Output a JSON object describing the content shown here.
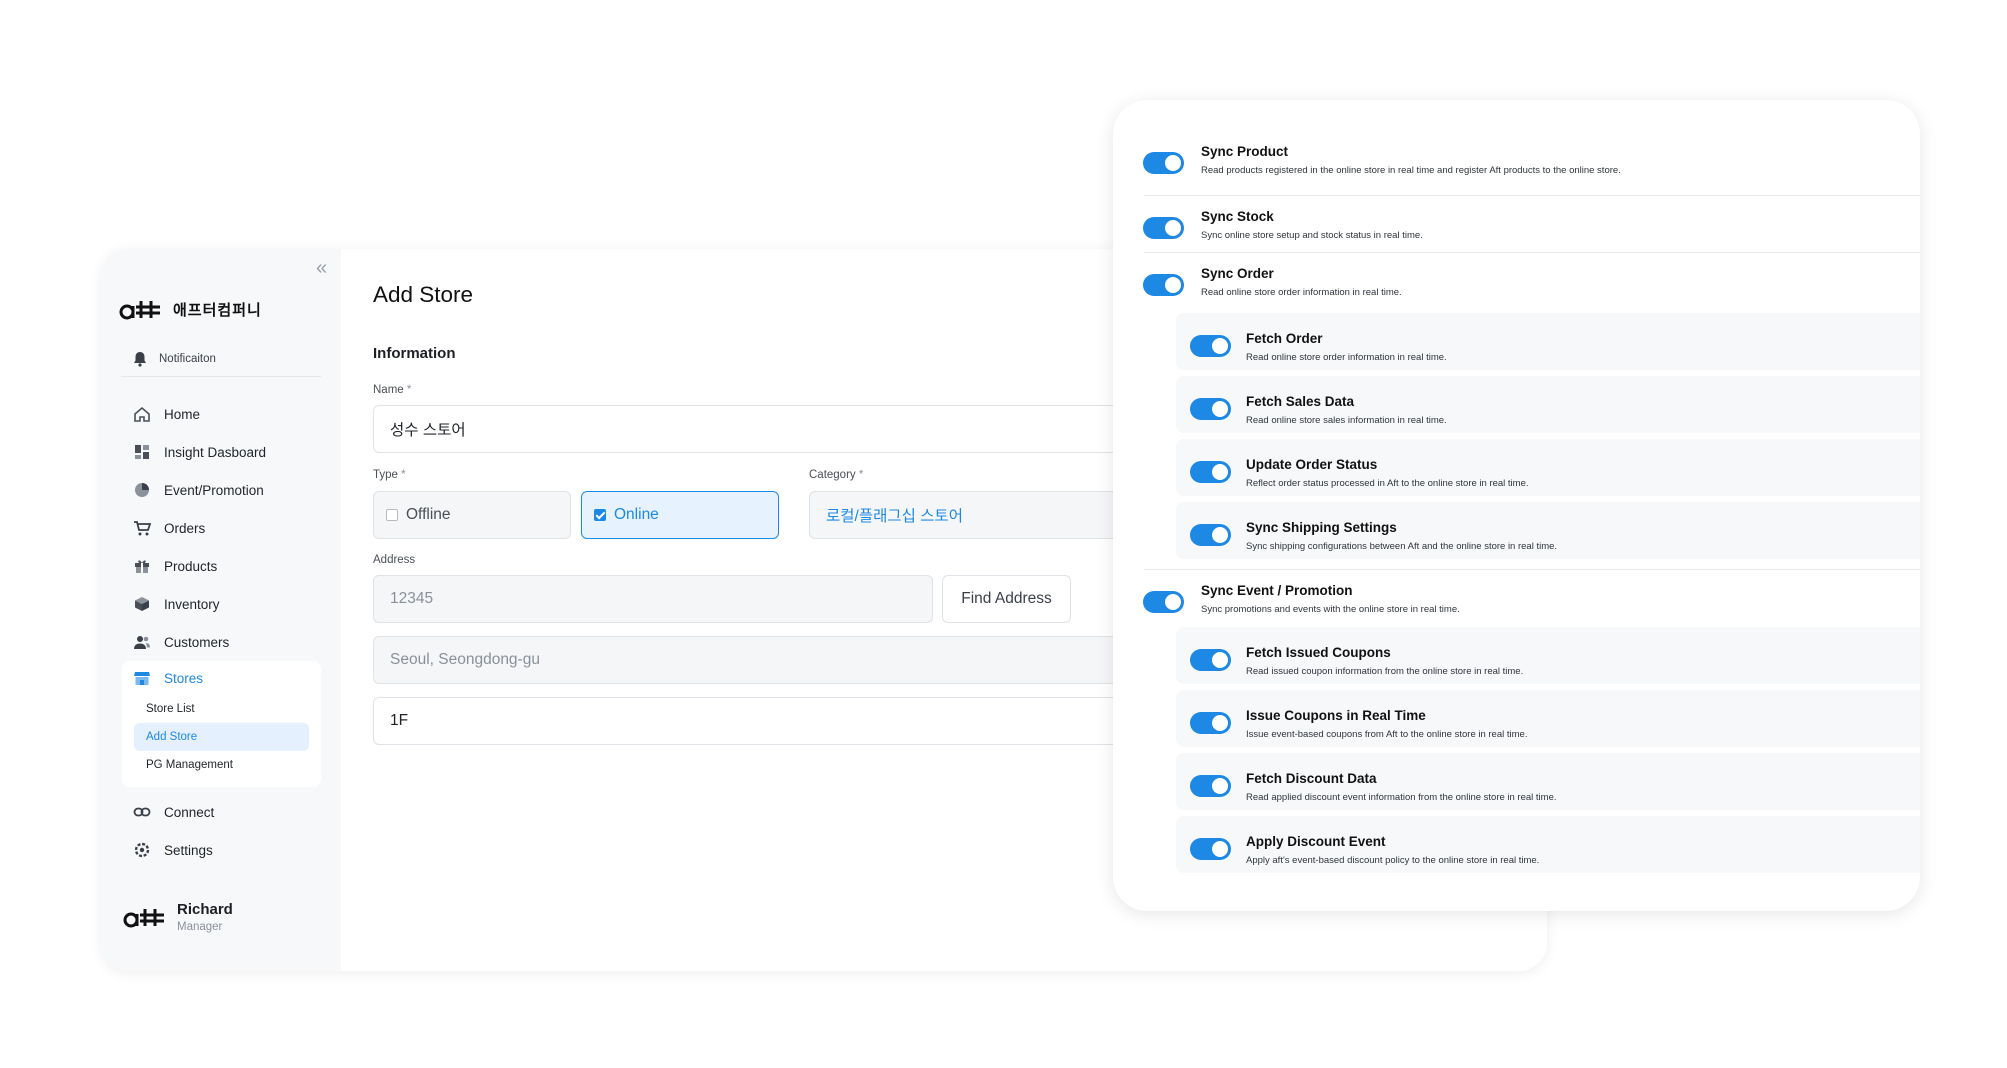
{
  "sidebar": {
    "brand_name": "애프터컴퍼니",
    "notification_label": "Notificaiton",
    "nav": [
      {
        "label": "Home",
        "icon": "home-icon"
      },
      {
        "label": "Insight Dasboard",
        "icon": "dashboard-icon"
      },
      {
        "label": "Event/Promotion",
        "icon": "pie-chart-icon"
      },
      {
        "label": "Orders",
        "icon": "cart-icon"
      },
      {
        "label": "Products",
        "icon": "gift-icon"
      },
      {
        "label": "Inventory",
        "icon": "box-icon"
      }
    ],
    "customers_label": "Customers",
    "stores": {
      "label": "Stores",
      "items": [
        "Store List",
        "Add Store",
        "PG Management"
      ]
    },
    "connect_label": "Connect",
    "settings_label": "Settings",
    "user": {
      "name": "Richard",
      "role": "Manager"
    }
  },
  "main": {
    "title": "Add Store",
    "section": "Information",
    "name": {
      "label": "Name",
      "required_mark": "*",
      "value": "성수 스토어"
    },
    "type": {
      "label": "Type",
      "required_mark": "*",
      "options": [
        "Offline",
        "Online"
      ],
      "selected": "Online"
    },
    "category": {
      "label": "Category",
      "required_mark": "*",
      "value": "로컬/플래그십 스토어"
    },
    "address": {
      "label": "Address",
      "zip_placeholder": "12345",
      "find_button": "Find Address",
      "line1_placeholder": "Seoul, Seongdong-gu",
      "line2_value": "1F"
    }
  },
  "sync": {
    "product": {
      "title": "Sync Product",
      "desc": "Read products registered in the online store in real time and register Aft products to the online store.",
      "on": true
    },
    "stock": {
      "title": "Sync Stock",
      "desc": "Sync online store setup and stock status in real time.",
      "on": true
    },
    "order": {
      "title": "Sync Order",
      "desc": "Read online store order information in real time.",
      "on": true,
      "children": [
        {
          "title": "Fetch Order",
          "desc": "Read online store order information in real time.",
          "on": true
        },
        {
          "title": "Fetch Sales Data",
          "desc": "Read online store sales information in real time.",
          "on": true
        },
        {
          "title": "Update Order Status",
          "desc": "Reflect order status processed in Aft to the online store in real time.",
          "on": true
        },
        {
          "title": "Sync Shipping Settings",
          "desc": "Sync shipping configurations between Aft and the online store in real time.",
          "on": true
        }
      ]
    },
    "event": {
      "title": "Sync Event / Promotion",
      "desc": "Sync promotions and events with the online store in real time.",
      "on": true,
      "children": [
        {
          "title": "Fetch Issued Coupons",
          "desc": "Read issued coupon information from the online store in real time.",
          "on": true
        },
        {
          "title": "Issue Coupons in Real Time",
          "desc": "Issue event-based coupons from Aft to the online store in real time.",
          "on": true
        },
        {
          "title": "Fetch Discount Data",
          "desc": "Read applied discount event information from the online store in real time.",
          "on": true
        },
        {
          "title": "Apply Discount Event",
          "desc": "Apply aft's event-based discount policy to the online store in real time.",
          "on": true
        }
      ]
    }
  },
  "colors": {
    "accent": "#1e88e5",
    "sidebar_bg": "#f7f8fa",
    "selected_bg": "#e6f2fd"
  }
}
